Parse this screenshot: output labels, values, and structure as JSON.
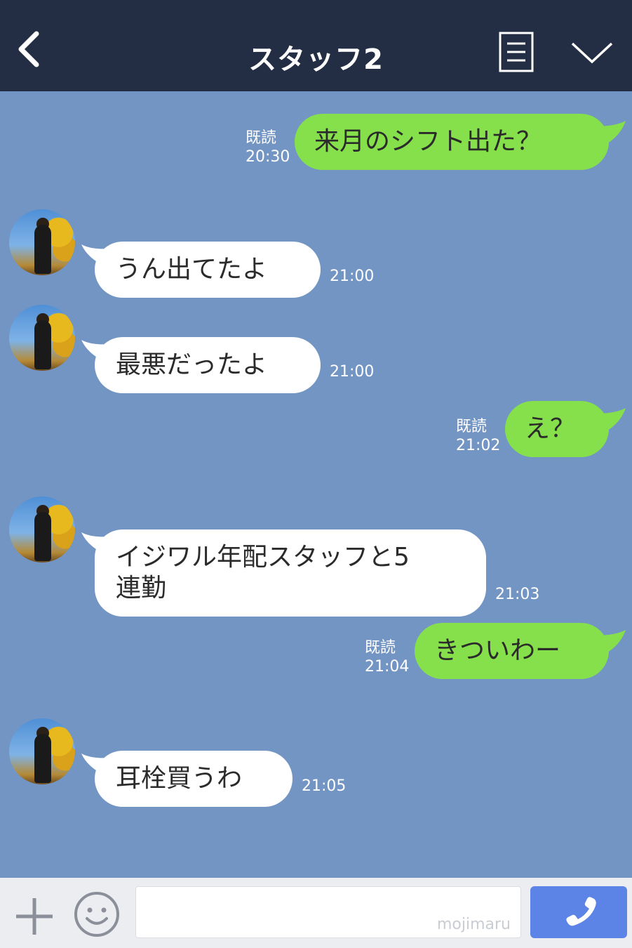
{
  "header": {
    "title": "スタッフ2",
    "back_icon": "chevron-left-icon",
    "menu_icon": "list-icon",
    "down_icon": "chevron-down-icon",
    "background": "#232d43"
  },
  "chat": {
    "background": "#7395c4",
    "messages": [
      {
        "direction": "out",
        "text": "来月のシフト出た？",
        "read": "既読",
        "time": "20:30"
      },
      {
        "direction": "in",
        "text": "うん出てたよ",
        "time": "21:00"
      },
      {
        "direction": "in",
        "text": "最悪だったよ",
        "time": "21:00"
      },
      {
        "direction": "out",
        "text": "え？",
        "read": "既読",
        "time": "21:02"
      },
      {
        "direction": "in",
        "text_line1": "イジワル年配スタッフと5",
        "text_line2": "連勤",
        "time": "21:03"
      },
      {
        "direction": "out",
        "text": "きついわー",
        "read": "既読",
        "time": "21:04"
      },
      {
        "direction": "in",
        "text": "耳栓買うわ",
        "time": "21:05"
      }
    ],
    "out_bubble_color": "#86e04b",
    "in_bubble_color": "#ffffff"
  },
  "footer": {
    "plus_icon": "plus-icon",
    "emoji_icon": "smiley-icon",
    "input_watermark": "mojimaru",
    "call_icon": "phone-icon",
    "call_button_color": "#5b84e6"
  }
}
